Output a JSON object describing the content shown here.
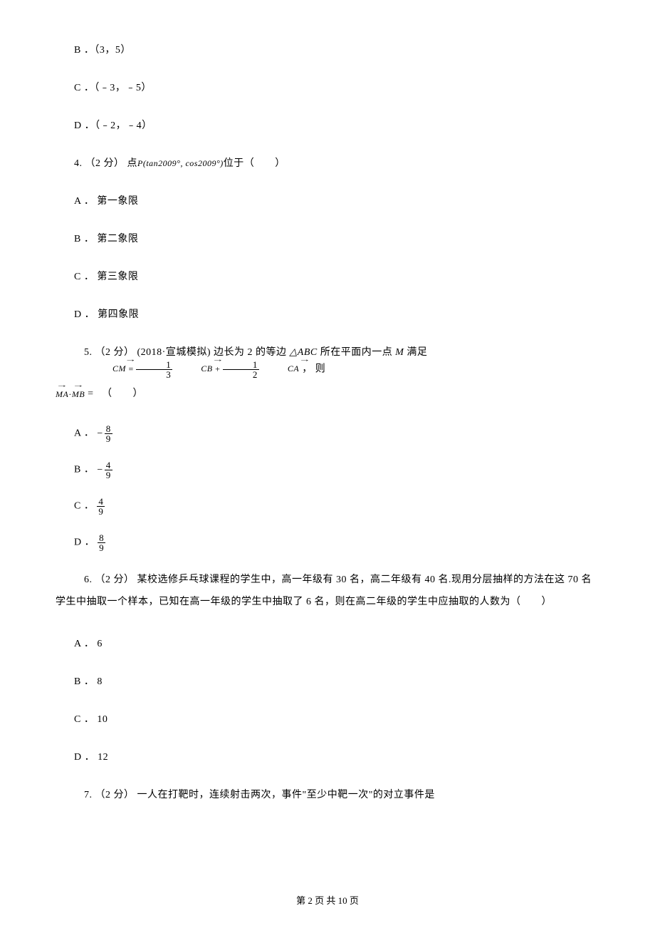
{
  "q3_options": {
    "B": "B ．（3，5）",
    "C": "C ．（﹣3，﹣5）",
    "D": "D ．（﹣2，﹣4）"
  },
  "q4": {
    "stem_pre": "4. （2 分）  点",
    "point_expr": "P(tan2009°, cos2009°)",
    "stem_post": "位于（　　）",
    "A": "A ． 第一象限",
    "B": "B ． 第二象限",
    "C": "C ． 第三象限",
    "D": "D ． 第四象限"
  },
  "q5": {
    "stem_pre": "5. （2 分） (2018·宣城模拟)  边长为 2 的等边 ",
    "triangle": "△ABC",
    "stem_mid1": " 所在平面内一点 ",
    "M": "M",
    "stem_mid2": " 满足 ",
    "eq_lhs": "CM",
    "eq_eq": " = ",
    "f1_num": "1",
    "f1_den": "3",
    "v1": "CB",
    "plus": " + ",
    "f2_num": "1",
    "f2_den": "2",
    "v2": "CA",
    "stem_post": " ， 则",
    "cont_lhs1": "MA",
    "cont_dot": "·",
    "cont_lhs2": "MB",
    "cont_eq": " = 　（　　）",
    "A_label": "A ．",
    "B_label": "B ．",
    "C_label": "C ．",
    "D_label": "D ．",
    "A_num": "8",
    "A_den": "9",
    "B_num": "4",
    "B_den": "9",
    "C_num": "4",
    "C_den": "9",
    "D_num": "8",
    "D_den": "9"
  },
  "q6": {
    "stem": "6. （2 分）  某校选修乒乓球课程的学生中，高一年级有 30 名，高二年级有 40 名.现用分层抽样的方法在这 70 名学生中抽取一个样本，已知在高一年级的学生中抽取了 6 名，则在高二年级的学生中应抽取的人数为（　　）",
    "A": "A ． 6",
    "B": "B ． 8",
    "C": "C ． 10",
    "D": "D ． 12"
  },
  "q7": {
    "stem": "7. （2 分）  一人在打靶时，连续射击两次，事件\"至少中靶一次\"的对立事件是"
  },
  "footer": "第 2 页 共 10 页"
}
